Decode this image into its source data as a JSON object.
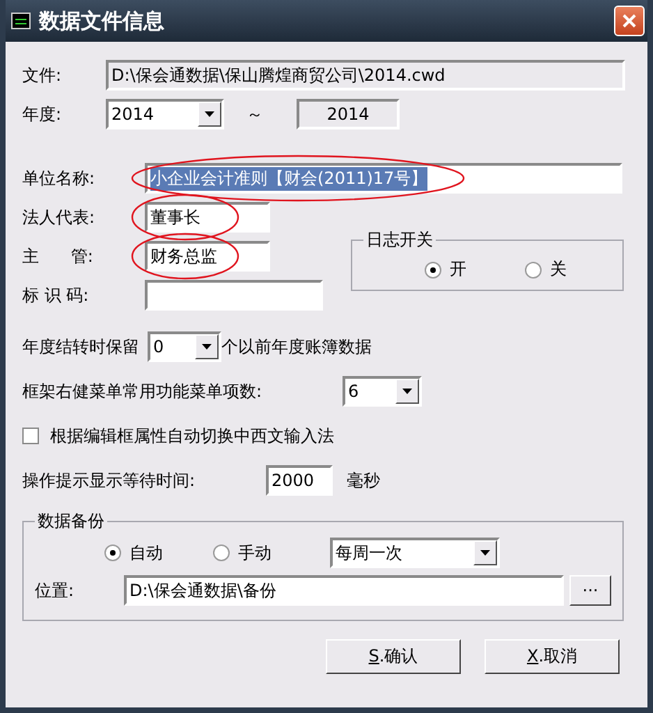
{
  "window": {
    "title": "数据文件信息"
  },
  "file": {
    "label": "文件:",
    "value": "D:\\保会通数据\\保山腾煌商贸公司\\2014.cwd"
  },
  "year": {
    "label": "年度:",
    "value": "2014",
    "separator": "～",
    "end": "2014"
  },
  "fields": [
    {
      "label": "单位名称:",
      "value": "小企业会计准则【财会(2011)17号】",
      "selected": true,
      "circled": true,
      "kind": "wide"
    },
    {
      "label": "法人代表:",
      "value": "董事长",
      "selected": false,
      "circled": true,
      "kind": "short"
    },
    {
      "label": "主      管:",
      "value": "财务总监",
      "selected": false,
      "circled": true,
      "kind": "short"
    },
    {
      "label": "标 识 码:",
      "kind": "medium"
    }
  ],
  "log": {
    "title": "日志开关",
    "options": [
      {
        "label": "开",
        "selected": true
      },
      {
        "label": "关",
        "selected": false
      }
    ]
  },
  "carry": {
    "prefix": "年度结转时保留",
    "value": "0",
    "suffix": "个以前年度账簿数据"
  },
  "menu_items": {
    "label": "框架右健菜单常用功能菜单项数:",
    "value": "6"
  },
  "ime_switch": {
    "label": "根据编辑框属性自动切换中西文输入法",
    "checked": false
  },
  "tooltip_delay": {
    "label": "操作提示显示等待时间:",
    "value": "2000",
    "unit": "毫秒"
  },
  "backup": {
    "title": "数据备份",
    "modes": [
      {
        "label": "自动",
        "selected": true
      },
      {
        "label": "手动",
        "selected": false
      }
    ],
    "frequency": "每周一次",
    "location_label": "位置:",
    "location": "D:\\保会通数据\\备份",
    "browse": "···"
  },
  "buttons": [
    {
      "mnemonic": "S",
      "label": ".确认"
    },
    {
      "mnemonic": "X",
      "label": ".取消"
    }
  ]
}
